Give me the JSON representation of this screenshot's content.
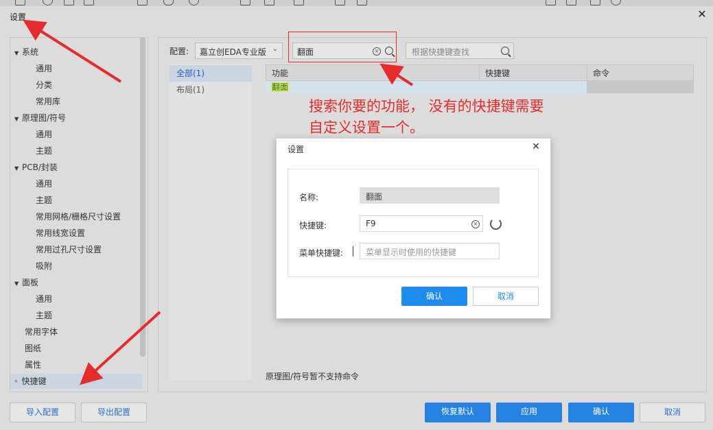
{
  "window": {
    "title": "设置"
  },
  "sidebar": {
    "items": [
      {
        "label": "系统",
        "level": 0,
        "expanded": true
      },
      {
        "label": "通用",
        "level": 1
      },
      {
        "label": "分类",
        "level": 1
      },
      {
        "label": "常用库",
        "level": 1
      },
      {
        "label": "原理图/符号",
        "level": 0,
        "expanded": true
      },
      {
        "label": "通用",
        "level": 1
      },
      {
        "label": "主题",
        "level": 1
      },
      {
        "label": "PCB/封装",
        "level": 0,
        "expanded": true
      },
      {
        "label": "通用",
        "level": 1
      },
      {
        "label": "主题",
        "level": 1
      },
      {
        "label": "常用网格/栅格尺寸设置",
        "level": 1
      },
      {
        "label": "常用线宽设置",
        "level": 1
      },
      {
        "label": "常用过孔尺寸设置",
        "level": 1
      },
      {
        "label": "吸附",
        "level": 1
      },
      {
        "label": "面板",
        "level": 0,
        "expanded": true
      },
      {
        "label": "通用",
        "level": 1
      },
      {
        "label": "主题",
        "level": 1
      },
      {
        "label": "常用字体",
        "level": 0
      },
      {
        "label": "图纸",
        "level": 0
      },
      {
        "label": "属性",
        "level": 0
      },
      {
        "label": "快捷键",
        "level": 0,
        "selected": true,
        "marker": "*"
      }
    ]
  },
  "config": {
    "label": "配置:",
    "profile": "嘉立创EDA专业版",
    "function_search_value": "翻面",
    "key_search_placeholder": "根据快捷键查找"
  },
  "categories": [
    {
      "label": "全部(1)",
      "active": true
    },
    {
      "label": "布局(1)",
      "active": false
    }
  ],
  "table": {
    "headers": [
      "功能",
      "快捷键",
      "命令"
    ],
    "rows": [
      {
        "function": "翻面",
        "shortcut": "",
        "command": ""
      }
    ]
  },
  "annotation": {
    "line1": "搜索你要的功能， 没有的快捷键需要",
    "line2": "自定义设置一个。"
  },
  "note": "原理图/符号暂不支持命令",
  "dialog": {
    "title": "设置",
    "name_label": "名称:",
    "name_value": "翻面",
    "shortcut_label": "快捷键:",
    "shortcut_value": "F9",
    "menu_shortcut_label": "菜单快捷键:",
    "menu_shortcut_placeholder": "菜单显示时使用的快捷键",
    "confirm": "确认",
    "cancel": "取消"
  },
  "footer": {
    "import": "导入配置",
    "export": "导出配置",
    "restore": "恢复默认",
    "apply": "应用",
    "confirm": "确认",
    "cancel": "取消"
  },
  "colors": {
    "accent": "#1e8bef",
    "annotation_red": "#e52b2b",
    "highlight": "#e7e26a"
  }
}
